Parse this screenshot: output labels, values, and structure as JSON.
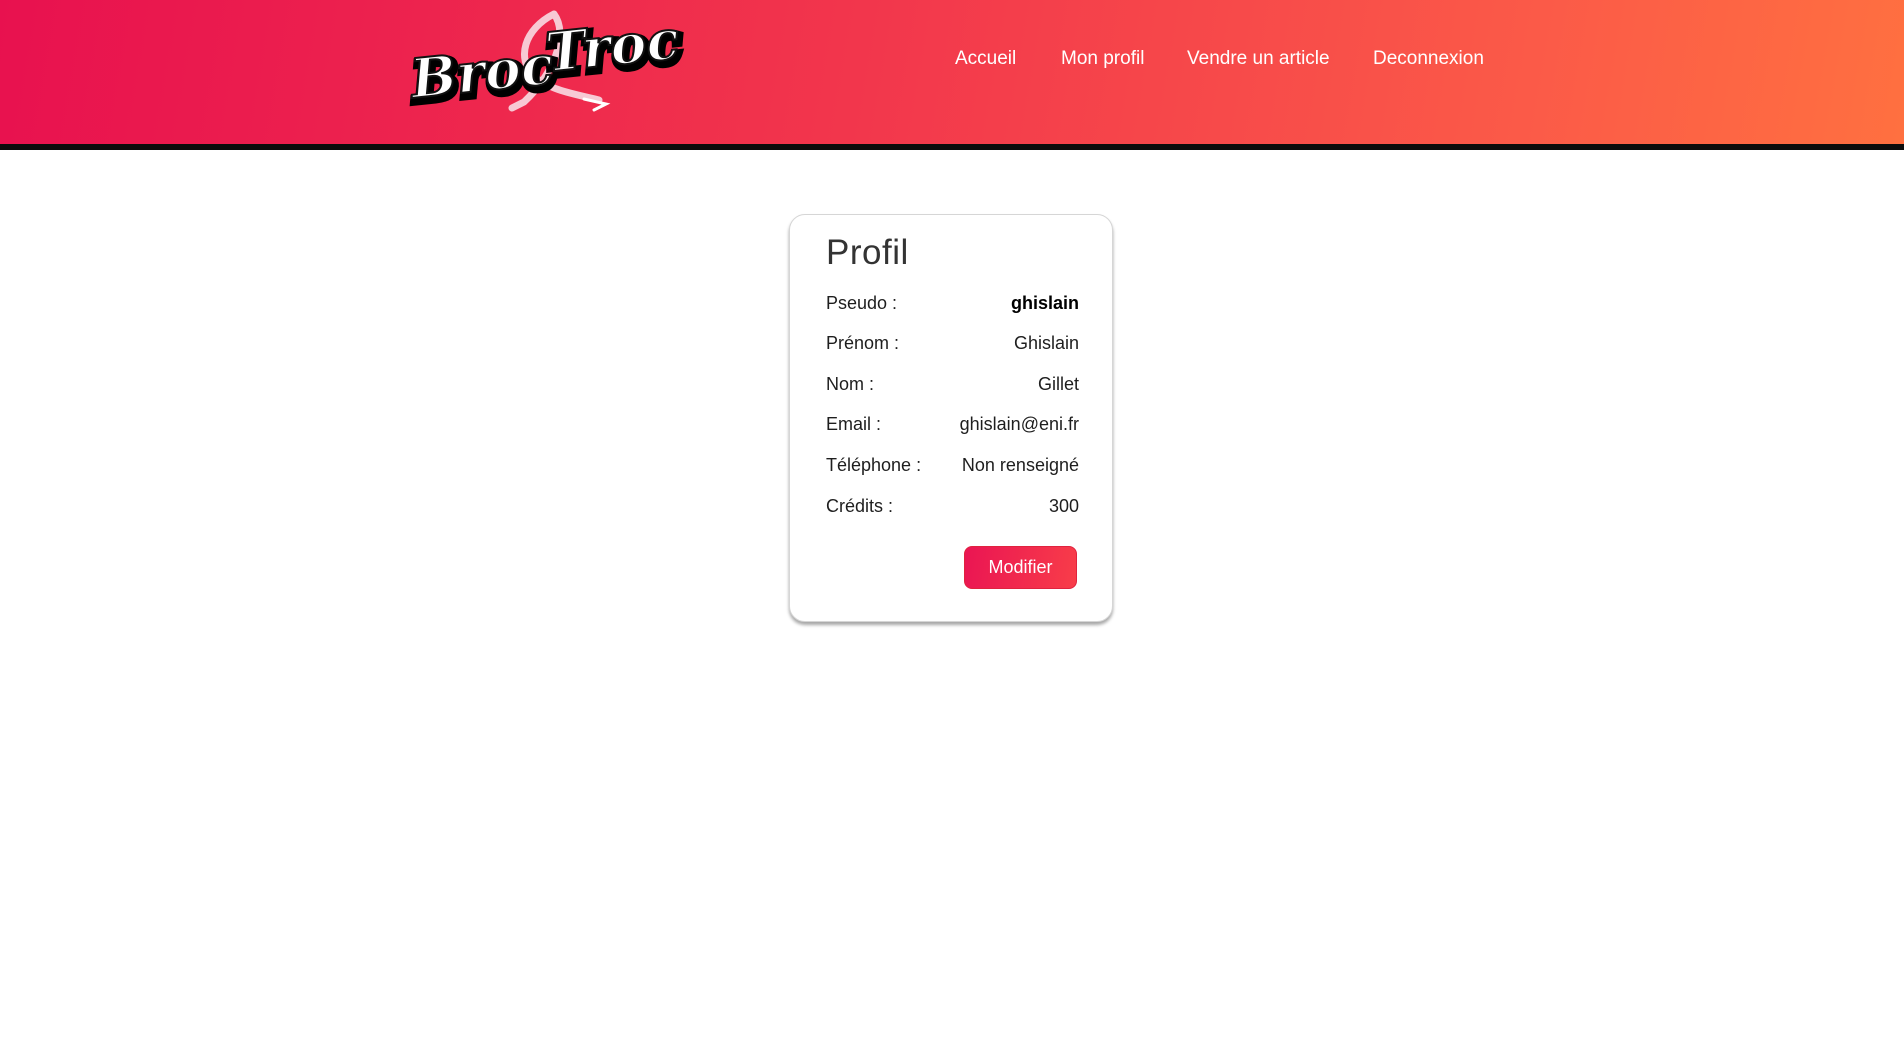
{
  "header": {
    "logo_text": "Broc & Troc",
    "colors": {
      "gradient_start": "#e8114f",
      "gradient_end": "#ff7040",
      "border": "#0c0c0c"
    },
    "nav": [
      {
        "label": "Accueil"
      },
      {
        "label": "Mon profil"
      },
      {
        "label": "Vendre un article"
      },
      {
        "label": "Deconnexion"
      }
    ]
  },
  "profile": {
    "title": "Profil",
    "fields": [
      {
        "label": "Pseudo :",
        "value": "ghislain"
      },
      {
        "label": "Prénom :",
        "value": "Ghislain"
      },
      {
        "label": "Nom :",
        "value": "Gillet"
      },
      {
        "label": "Email :",
        "value": "ghislain@eni.fr"
      },
      {
        "label": "Téléphone :",
        "value": "Non renseigné"
      },
      {
        "label": "Crédits :",
        "value": "300"
      }
    ],
    "modify_button": "Modifier",
    "colors": {
      "button": "#f02a4d"
    }
  }
}
